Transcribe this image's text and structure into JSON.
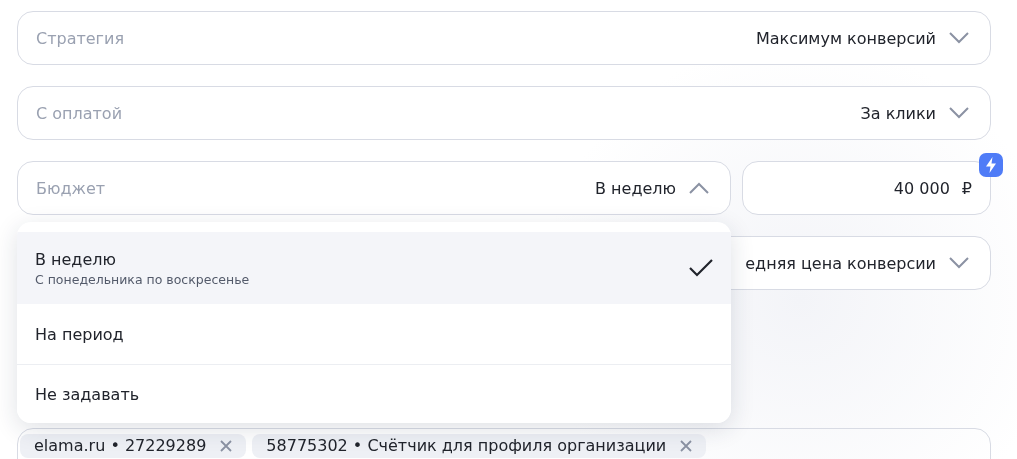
{
  "fields": [
    {
      "label": "Стратегия",
      "value": "Максимум конверсий",
      "expanded": false
    },
    {
      "label": "С оплатой",
      "value": "За клики",
      "expanded": false
    }
  ],
  "budget": {
    "label": "Бюджет",
    "value": "В неделю",
    "expanded": true,
    "amount": "40 000",
    "currency": "₽"
  },
  "hidden_field": {
    "value": "едняя цена конверсии",
    "expanded": false
  },
  "dropdown": {
    "options": [
      {
        "label": "В неделю",
        "hint": "С понедельника по воскресенье",
        "selected": true
      },
      {
        "label": "На период",
        "selected": false
      },
      {
        "label": "Не задавать",
        "selected": false
      }
    ]
  },
  "tags": [
    {
      "label": "elama.ru • 27229289"
    },
    {
      "label": "58775302 • Счётчик для профиля организации"
    }
  ]
}
